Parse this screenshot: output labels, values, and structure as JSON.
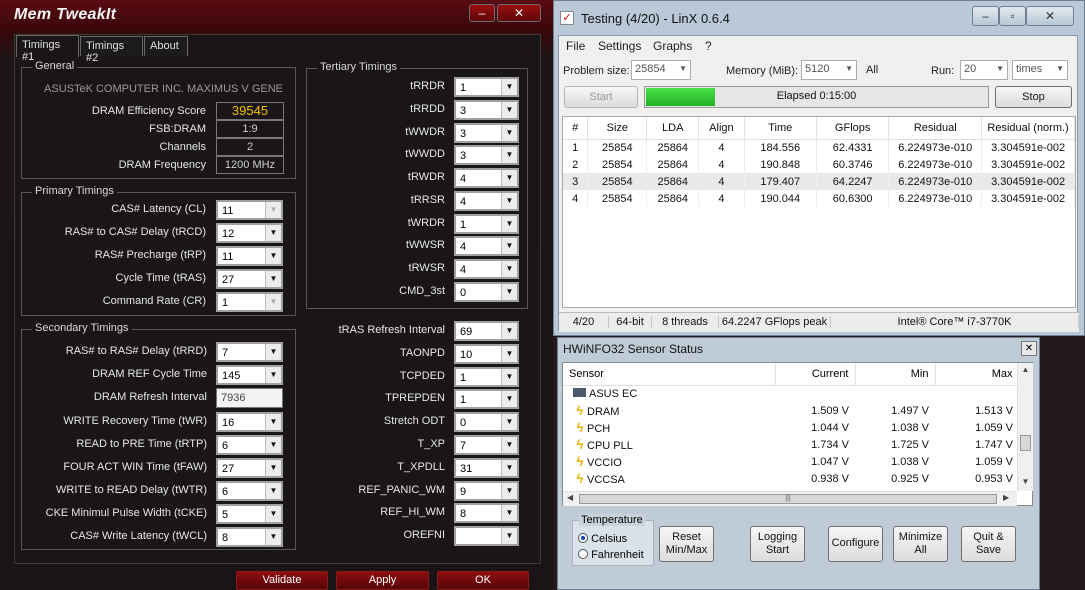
{
  "memtweakit": {
    "title": "Mem TweakIt",
    "tabs": [
      "Timings #1",
      "Timings #2",
      "About"
    ],
    "general": {
      "title": "General",
      "board": "ASUSTeK COMPUTER INC. MAXIMUS V GENE",
      "efficiency_label": "DRAM Efficiency Score",
      "efficiency_value": "39545",
      "fsb_label": "FSB:DRAM",
      "fsb_value": "1:9",
      "channels_label": "Channels",
      "channels_value": "2",
      "freq_label": "DRAM Frequency",
      "freq_value": "1200 MHz"
    },
    "primary": {
      "title": "Primary Timings",
      "items": [
        {
          "label": "CAS# Latency (CL)",
          "value": "11"
        },
        {
          "label": "RAS# to CAS# Delay (tRCD)",
          "value": "12"
        },
        {
          "label": "RAS# Precharge (tRP)",
          "value": "11"
        },
        {
          "label": "Cycle Time (tRAS)",
          "value": "27"
        },
        {
          "label": "Command Rate (CR)",
          "value": "1"
        }
      ]
    },
    "secondary": {
      "title": "Secondary Timings",
      "items": [
        {
          "label": "RAS# to RAS# Delay (tRRD)",
          "value": "7"
        },
        {
          "label": "DRAM REF Cycle Time",
          "value": "145"
        },
        {
          "label": "DRAM Refresh Interval",
          "value": "7936"
        },
        {
          "label": "WRITE Recovery Time (tWR)",
          "value": "16"
        },
        {
          "label": "READ to PRE Time (tRTP)",
          "value": "6"
        },
        {
          "label": "FOUR ACT WIN Time (tFAW)",
          "value": "27"
        },
        {
          "label": "WRITE to READ Delay (tWTR)",
          "value": "6"
        },
        {
          "label": "CKE Minimul Pulse Width (tCKE)",
          "value": "5"
        },
        {
          "label": "CAS# Write Latency (tWCL)",
          "value": "8"
        }
      ]
    },
    "tertiary": {
      "title": "Tertiary Timings",
      "items": [
        {
          "label": "tRRDR",
          "value": "1"
        },
        {
          "label": "tRRDD",
          "value": "3"
        },
        {
          "label": "tWWDR",
          "value": "3"
        },
        {
          "label": "tWWDD",
          "value": "3"
        },
        {
          "label": "tRWDR",
          "value": "4"
        },
        {
          "label": "tRRSR",
          "value": "4"
        },
        {
          "label": "tWRDR",
          "value": "1"
        },
        {
          "label": "tWWSR",
          "value": "4"
        },
        {
          "label": "tRWSR",
          "value": "4"
        },
        {
          "label": "CMD_3st",
          "value": "0"
        }
      ]
    },
    "right_lower": [
      {
        "label": "tRAS Refresh Interval",
        "value": "69"
      },
      {
        "label": "TAONPD",
        "value": "10"
      },
      {
        "label": "TCPDED",
        "value": "1"
      },
      {
        "label": "TPREPDEN",
        "value": "1"
      },
      {
        "label": "Stretch ODT",
        "value": "0"
      },
      {
        "label": "T_XP",
        "value": "7"
      },
      {
        "label": "T_XPDLL",
        "value": "31"
      },
      {
        "label": "REF_PANIC_WM",
        "value": "9"
      },
      {
        "label": "REF_HI_WM",
        "value": "8"
      },
      {
        "label": "OREFNI",
        "value": ""
      }
    ],
    "buttons": {
      "validate": "Validate",
      "apply": "Apply",
      "ok": "OK"
    }
  },
  "linx": {
    "title": "Testing (4/20) - LinX 0.6.4",
    "menu": [
      "File",
      "Settings",
      "Graphs",
      "?"
    ],
    "problem_label": "Problem size:",
    "problem_value": "25854",
    "memory_label": "Memory (MiB):",
    "memory_value": "5120",
    "all_label": "All",
    "run_label": "Run:",
    "run_value": "20",
    "times_value": "times",
    "start_label": "Start",
    "elapsed": "Elapsed 0:15:00",
    "progress": 0.2,
    "stop_label": "Stop",
    "columns": [
      "#",
      "Size",
      "LDA",
      "Align",
      "Time",
      "GFlops",
      "Residual",
      "Residual (norm.)"
    ],
    "rows": [
      [
        "1",
        "25854",
        "25864",
        "4",
        "184.556",
        "62.4331",
        "6.224973e-010",
        "3.304591e-002"
      ],
      [
        "2",
        "25854",
        "25864",
        "4",
        "190.848",
        "60.3746",
        "6.224973e-010",
        "3.304591e-002"
      ],
      [
        "3",
        "25854",
        "25864",
        "4",
        "179.407",
        "64.2247",
        "6.224973e-010",
        "3.304591e-002"
      ],
      [
        "4",
        "25854",
        "25864",
        "4",
        "190.044",
        "60.6300",
        "6.224973e-010",
        "3.304591e-002"
      ]
    ],
    "status": [
      "4/20",
      "64-bit",
      "8 threads",
      "64.2247 GFlops peak",
      "Intel® Core™ i7-3770K"
    ]
  },
  "hwinfo": {
    "title": "HWiNFO32 Sensor Status",
    "columns": [
      "Sensor",
      "Current",
      "Min",
      "Max"
    ],
    "group": "ASUS EC",
    "rows": [
      {
        "name": "DRAM",
        "current": "1.509 V",
        "min": "1.497 V",
        "max": "1.513 V"
      },
      {
        "name": "PCH",
        "current": "1.044 V",
        "min": "1.038 V",
        "max": "1.059 V"
      },
      {
        "name": "CPU PLL",
        "current": "1.734 V",
        "min": "1.725 V",
        "max": "1.747 V"
      },
      {
        "name": "VCCIO",
        "current": "1.047 V",
        "min": "1.038 V",
        "max": "1.059 V"
      },
      {
        "name": "VCCSA",
        "current": "0.938 V",
        "min": "0.925 V",
        "max": "0.953 V"
      }
    ],
    "temperature": {
      "title": "Temperature",
      "celsius": "Celsius",
      "fahrenheit": "Fahrenheit"
    },
    "buttons": {
      "reset": "Reset Min/Max",
      "logging": "Logging Start",
      "configure": "Configure",
      "minimize": "Minimize All",
      "quit": "Quit & Save"
    }
  }
}
